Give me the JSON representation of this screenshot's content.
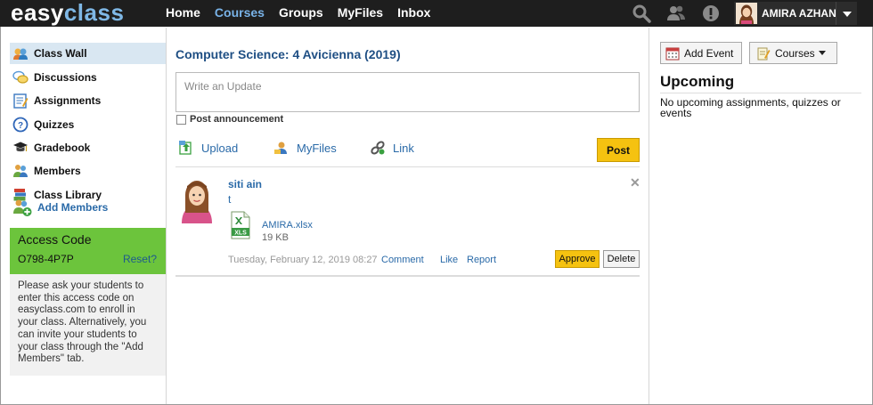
{
  "brand": {
    "part1": "easy",
    "part2": "class"
  },
  "nav": {
    "items": [
      "Home",
      "Courses",
      "Groups",
      "MyFiles",
      "Inbox"
    ],
    "active": "Courses"
  },
  "user": {
    "name": "AMIRA AZHAN"
  },
  "sidebar": {
    "items": [
      {
        "label": "Class Wall",
        "icon": "class-wall-icon",
        "active": true
      },
      {
        "label": "Discussions",
        "icon": "discussions-icon"
      },
      {
        "label": "Assignments",
        "icon": "assignments-icon"
      },
      {
        "label": "Quizzes",
        "icon": "quizzes-icon"
      },
      {
        "label": "Gradebook",
        "icon": "gradebook-icon"
      },
      {
        "label": "Members",
        "icon": "members-icon"
      },
      {
        "label": "Class Library",
        "icon": "class-library-icon"
      }
    ],
    "add_members": "Add Members",
    "access_code": {
      "title": "Access Code",
      "code": "O798-4P7P",
      "reset": "Reset?",
      "description": "Please ask your students to enter this access code on easyclass.com to enroll in your class. Alternatively, you can invite your students to your class through the \"Add Members\" tab."
    }
  },
  "main": {
    "course_title": "Computer Science: 4 Avicienna (2019)",
    "update_placeholder": "Write an Update",
    "post_announcement": "Post announcement",
    "tools": {
      "upload": "Upload",
      "myfiles": "MyFiles",
      "link": "Link"
    },
    "post_button": "Post",
    "post": {
      "author": "siti ain",
      "body": "t",
      "file_name": "AMIRA.xlsx",
      "file_size": "19 KB",
      "file_type": "XLS",
      "timestamp": "Tuesday, February 12, 2019 08:27",
      "comment": "Comment",
      "like": "Like",
      "report": "Report",
      "approve": "Approve",
      "delete": "Delete",
      "close": "✕"
    }
  },
  "right": {
    "add_event": "Add Event",
    "courses": "Courses",
    "upcoming_title": "Upcoming",
    "upcoming_text": "No upcoming assignments, quizzes or events"
  },
  "colors": {
    "topbar": "#1e1e1e",
    "accent": "#2a6aa8",
    "access_bg": "#6cc43c",
    "button_yellow": "#f5c210"
  }
}
